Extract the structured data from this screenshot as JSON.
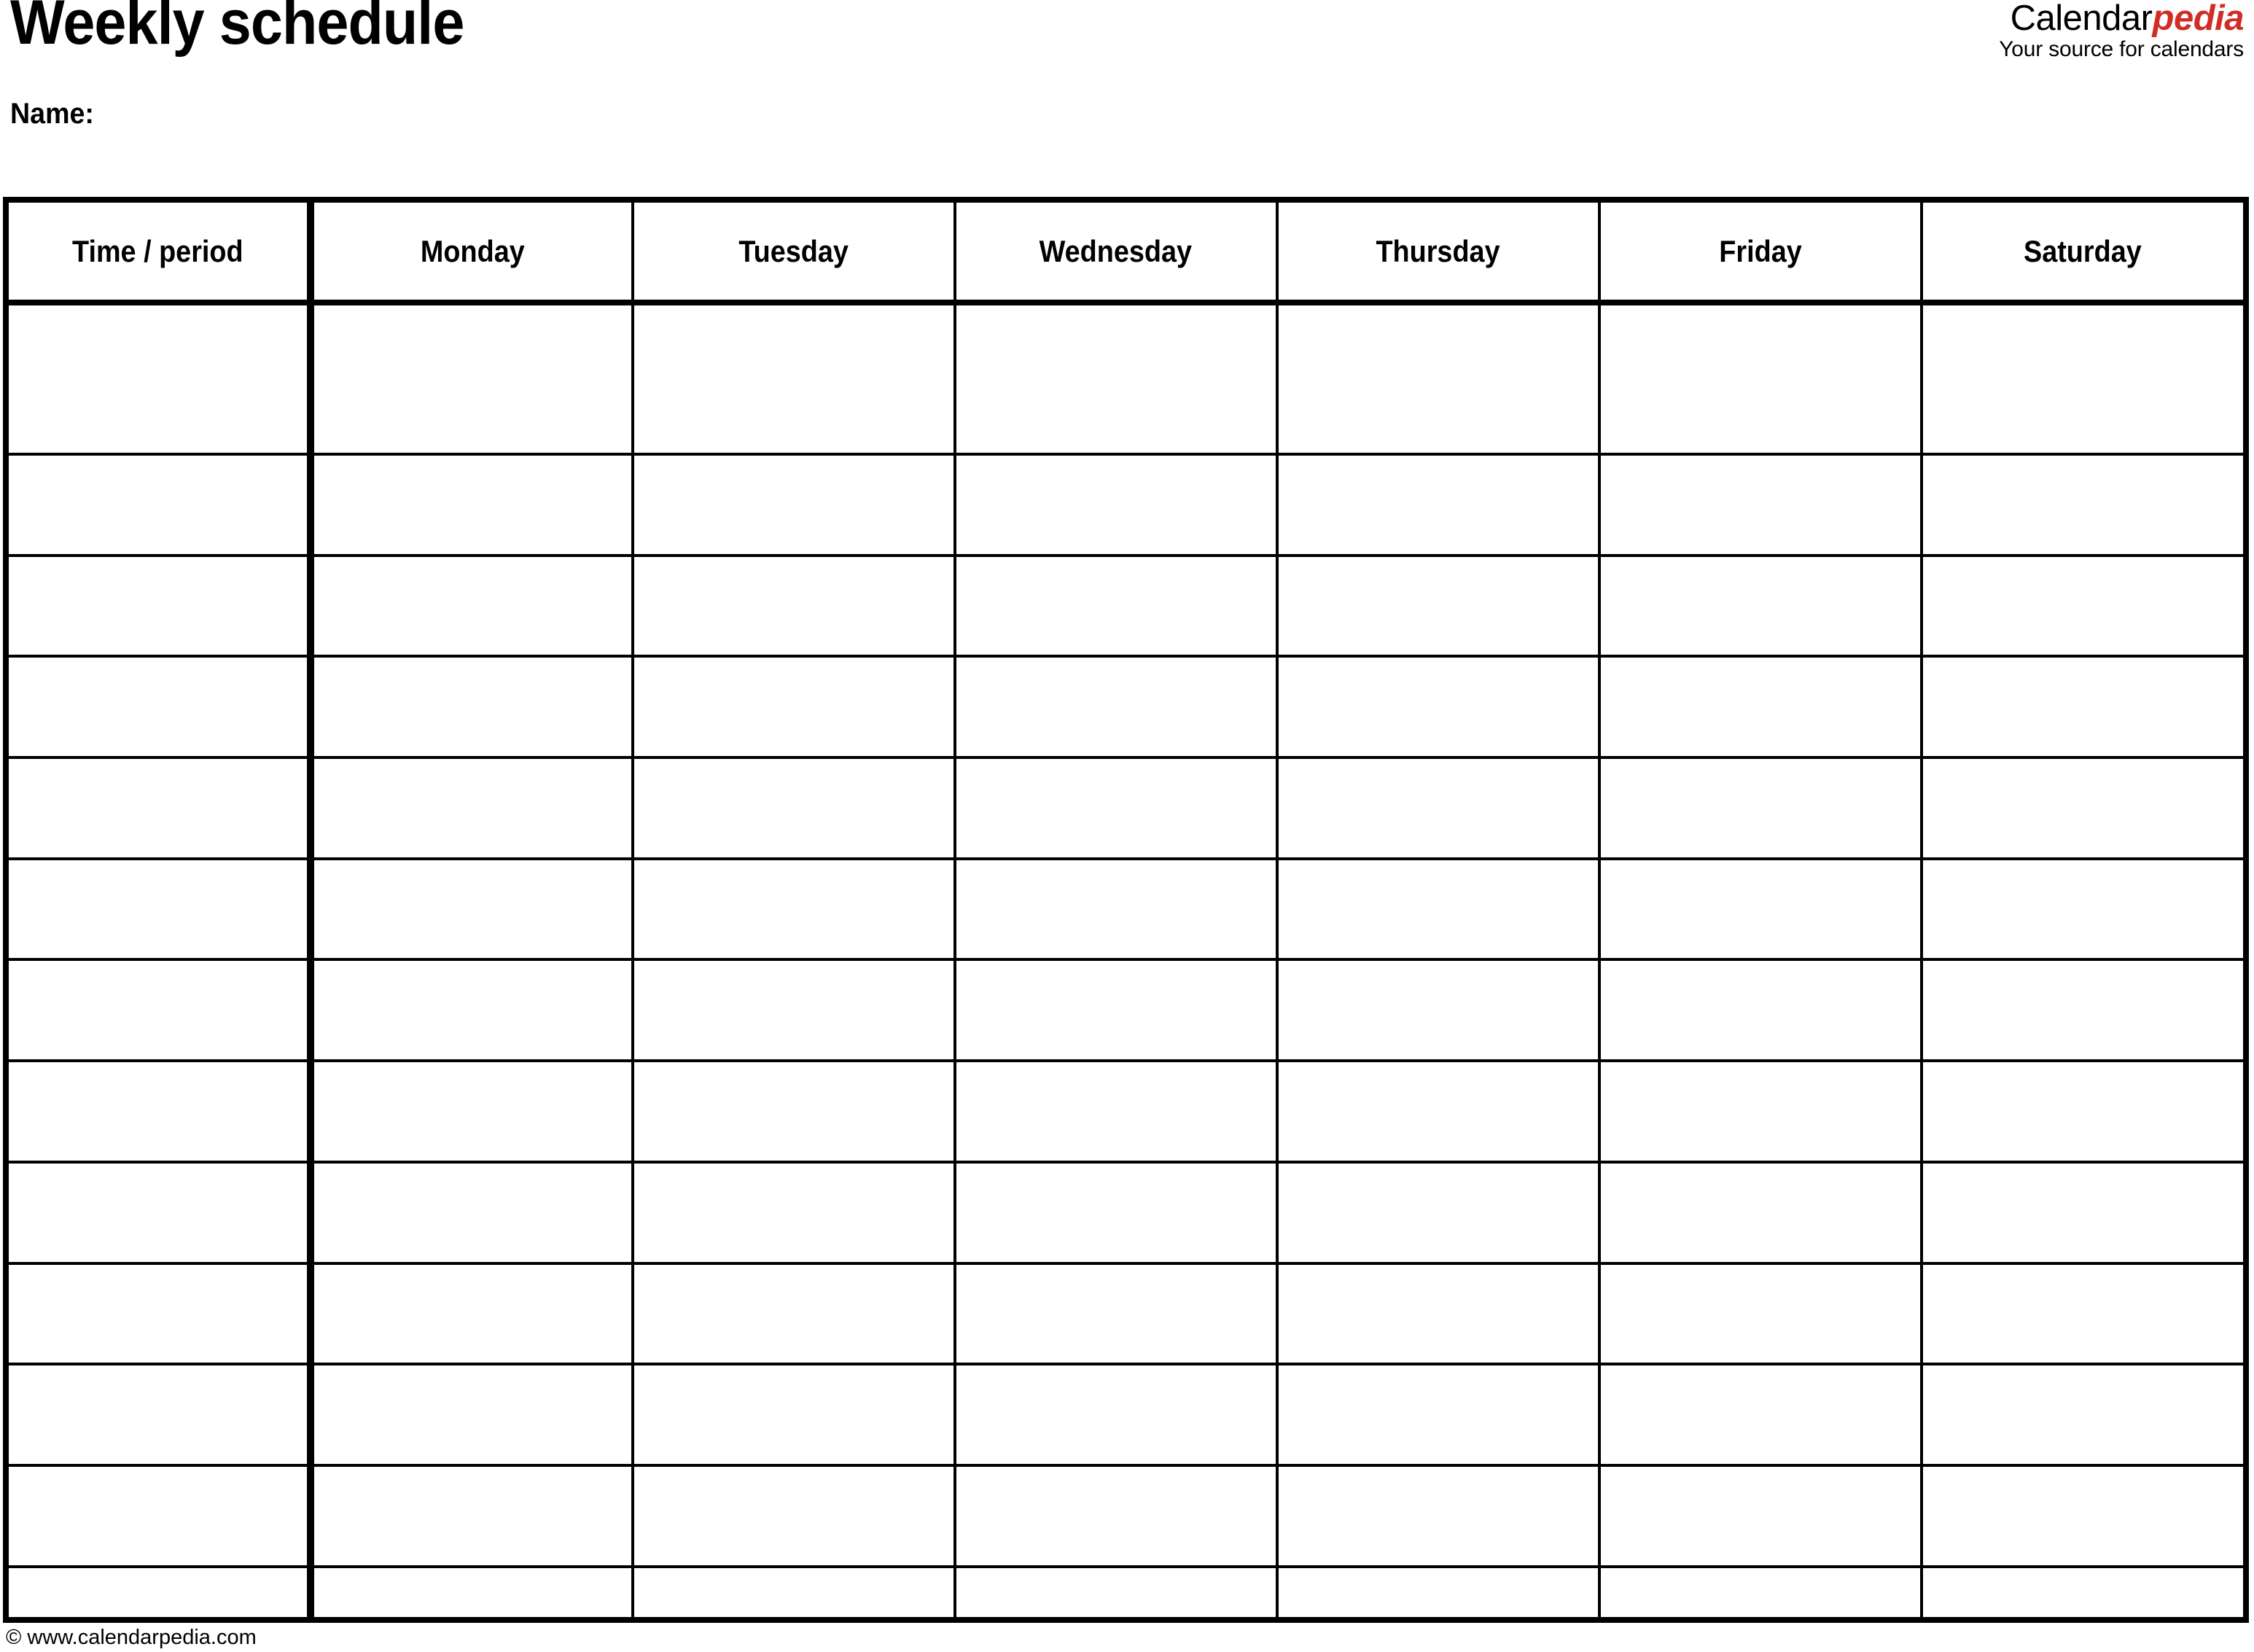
{
  "document": {
    "title": "Weekly schedule",
    "name_label": "Name:"
  },
  "brand": {
    "wordmark_primary": "Calendar",
    "wordmark_accent": "pedia",
    "tagline": "Your source for calendars",
    "accent_color": "#CF2E26",
    "primary_color": "#000000"
  },
  "table": {
    "columns": [
      {
        "key": "time",
        "label": "Time / period",
        "width_pct": 13.5,
        "emphasis": "thick-right-border"
      },
      {
        "key": "monday",
        "label": "Monday",
        "width_pct": 14.42
      },
      {
        "key": "tuesday",
        "label": "Tuesday",
        "width_pct": 14.42
      },
      {
        "key": "wednesday",
        "label": "Wednesday",
        "width_pct": 14.42
      },
      {
        "key": "thursday",
        "label": "Thursday",
        "width_pct": 14.42
      },
      {
        "key": "friday",
        "label": "Friday",
        "width_pct": 14.42
      },
      {
        "key": "saturday",
        "label": "Saturday",
        "width_pct": 14.4
      }
    ],
    "row_count": 13,
    "rows": [
      {
        "time": "",
        "monday": "",
        "tuesday": "",
        "wednesday": "",
        "thursday": "",
        "friday": "",
        "saturday": ""
      },
      {
        "time": "",
        "monday": "",
        "tuesday": "",
        "wednesday": "",
        "thursday": "",
        "friday": "",
        "saturday": ""
      },
      {
        "time": "",
        "monday": "",
        "tuesday": "",
        "wednesday": "",
        "thursday": "",
        "friday": "",
        "saturday": ""
      },
      {
        "time": "",
        "monday": "",
        "tuesday": "",
        "wednesday": "",
        "thursday": "",
        "friday": "",
        "saturday": ""
      },
      {
        "time": "",
        "monday": "",
        "tuesday": "",
        "wednesday": "",
        "thursday": "",
        "friday": "",
        "saturday": ""
      },
      {
        "time": "",
        "monday": "",
        "tuesday": "",
        "wednesday": "",
        "thursday": "",
        "friday": "",
        "saturday": ""
      },
      {
        "time": "",
        "monday": "",
        "tuesday": "",
        "wednesday": "",
        "thursday": "",
        "friday": "",
        "saturday": ""
      },
      {
        "time": "",
        "monday": "",
        "tuesday": "",
        "wednesday": "",
        "thursday": "",
        "friday": "",
        "saturday": ""
      },
      {
        "time": "",
        "monday": "",
        "tuesday": "",
        "wednesday": "",
        "thursday": "",
        "friday": "",
        "saturday": ""
      },
      {
        "time": "",
        "monday": "",
        "tuesday": "",
        "wednesday": "",
        "thursday": "",
        "friday": "",
        "saturday": ""
      },
      {
        "time": "",
        "monday": "",
        "tuesday": "",
        "wednesday": "",
        "thursday": "",
        "friday": "",
        "saturday": ""
      },
      {
        "time": "",
        "monday": "",
        "tuesday": "",
        "wednesday": "",
        "thursday": "",
        "friday": "",
        "saturday": ""
      },
      {
        "time": "",
        "monday": "",
        "tuesday": "",
        "wednesday": "",
        "thursday": "",
        "friday": "",
        "saturday": ""
      }
    ]
  },
  "footer": {
    "credit": "© www.calendarpedia.com"
  }
}
